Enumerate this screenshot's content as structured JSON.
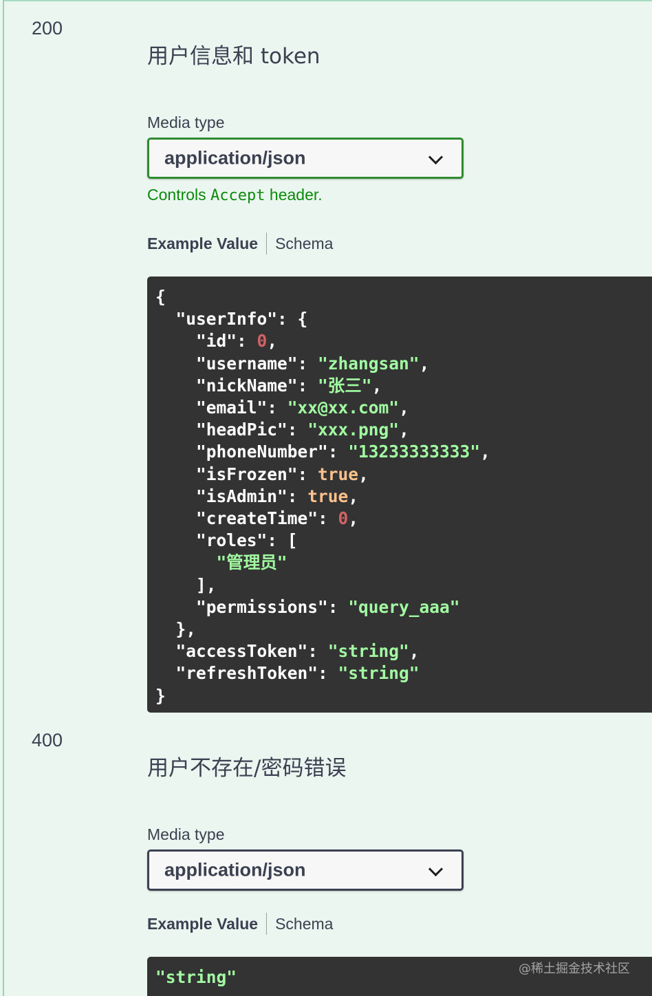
{
  "responses": [
    {
      "code": "200",
      "description": "用户信息和 token",
      "media_type_label": "Media type",
      "media_type_value": "application/json",
      "controls_note_prefix": "Controls ",
      "controls_note_code": "Accept",
      "controls_note_suffix": " header.",
      "tabs": {
        "example": "Example Value",
        "schema": "Schema"
      }
    },
    {
      "code": "400",
      "description": "用户不存在/密码错误",
      "media_type_label": "Media type",
      "media_type_value": "application/json",
      "tabs": {
        "example": "Example Value",
        "schema": "Schema"
      },
      "example_string": "\"string\""
    }
  ],
  "example_json": {
    "open": "{",
    "userInfo_key": "\"userInfo\"",
    "fields": [
      {
        "key": "\"id\"",
        "value": "0",
        "type": "number"
      },
      {
        "key": "\"username\"",
        "value": "\"zhangsan\"",
        "type": "string"
      },
      {
        "key": "\"nickName\"",
        "value": "\"张三\"",
        "type": "string"
      },
      {
        "key": "\"email\"",
        "value": "\"xx@xx.com\"",
        "type": "string"
      },
      {
        "key": "\"headPic\"",
        "value": "\"xxx.png\"",
        "type": "string"
      },
      {
        "key": "\"phoneNumber\"",
        "value": "\"13233333333\"",
        "type": "string"
      },
      {
        "key": "\"isFrozen\"",
        "value": "true",
        "type": "bool"
      },
      {
        "key": "\"isAdmin\"",
        "value": "true",
        "type": "bool"
      },
      {
        "key": "\"createTime\"",
        "value": "0",
        "type": "number"
      }
    ],
    "roles_key": "\"roles\"",
    "roles": [
      "\"管理员\""
    ],
    "permissions_key": "\"permissions\"",
    "permissions_value": "\"query_aaa\"",
    "accessToken_key": "\"accessToken\"",
    "accessToken_value": "\"string\"",
    "refreshToken_key": "\"refreshToken\"",
    "refreshToken_value": "\"string\"",
    "close": "}"
  },
  "watermark": "@稀土掘金技术社区",
  "colors": {
    "background": "#ebf6f0",
    "accent_green": "#2e8b2e",
    "code_bg": "#333333",
    "json_string": "#a2fca2",
    "json_number": "#d36363",
    "json_bool": "#fcc28c"
  }
}
